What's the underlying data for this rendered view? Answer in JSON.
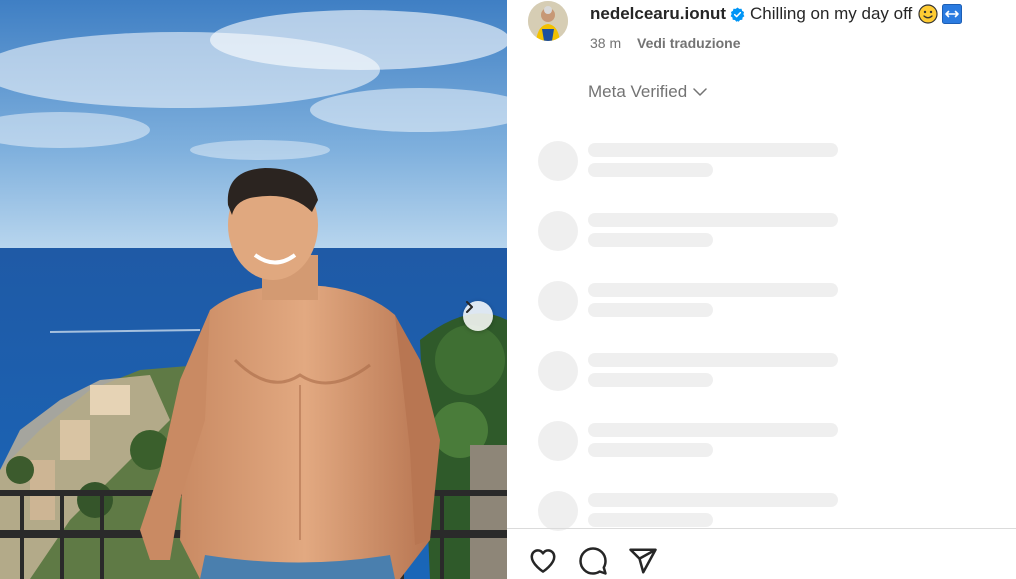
{
  "post": {
    "username": "nedelcearu.ionut",
    "caption": "Chilling on my day off",
    "time_ago": "38 m",
    "translate_label": "Vedi traduzione"
  },
  "meta_verified": {
    "label": "Meta Verified"
  },
  "comments_loading": {
    "placeholder_rows": 6
  },
  "icons": {
    "verified": "verified-badge-icon",
    "caption_emoji": "smiling-face-emoji-icon",
    "caption_emoji_2": "left-right-arrow-emoji-icon",
    "carousel_next": "chevron-right-icon",
    "like": "heart-icon",
    "comment": "comment-icon",
    "share": "paper-plane-icon",
    "dropdown": "chevron-down-icon"
  },
  "colors": {
    "verified_blue": "#0095f6",
    "text_primary": "#262626",
    "text_secondary": "#737373",
    "skeleton": "#efefef"
  }
}
